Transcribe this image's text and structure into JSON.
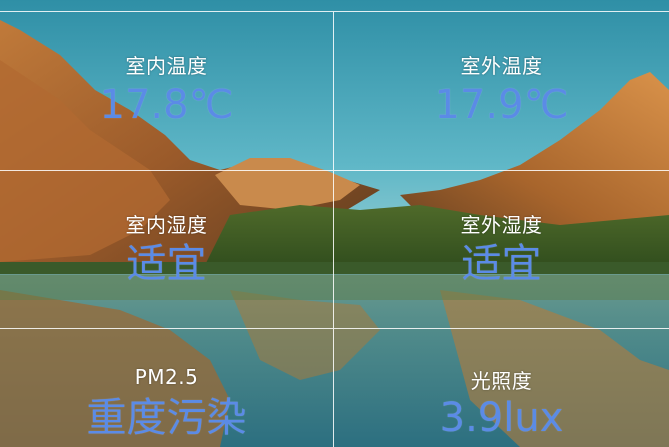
{
  "colors": {
    "value_text": "#5b8be6",
    "label_text": "#ffffff",
    "divider": "#ffffff"
  },
  "cards": [
    {
      "label": "室内温度",
      "value": "17.8℃"
    },
    {
      "label": "室外温度",
      "value": "17.9℃"
    },
    {
      "label": "室内湿度",
      "value": "适宜"
    },
    {
      "label": "室外湿度",
      "value": "适宜"
    },
    {
      "label": "PM2.5",
      "value": "重度污染"
    },
    {
      "label": "光照度",
      "value": "3.9lux"
    }
  ]
}
